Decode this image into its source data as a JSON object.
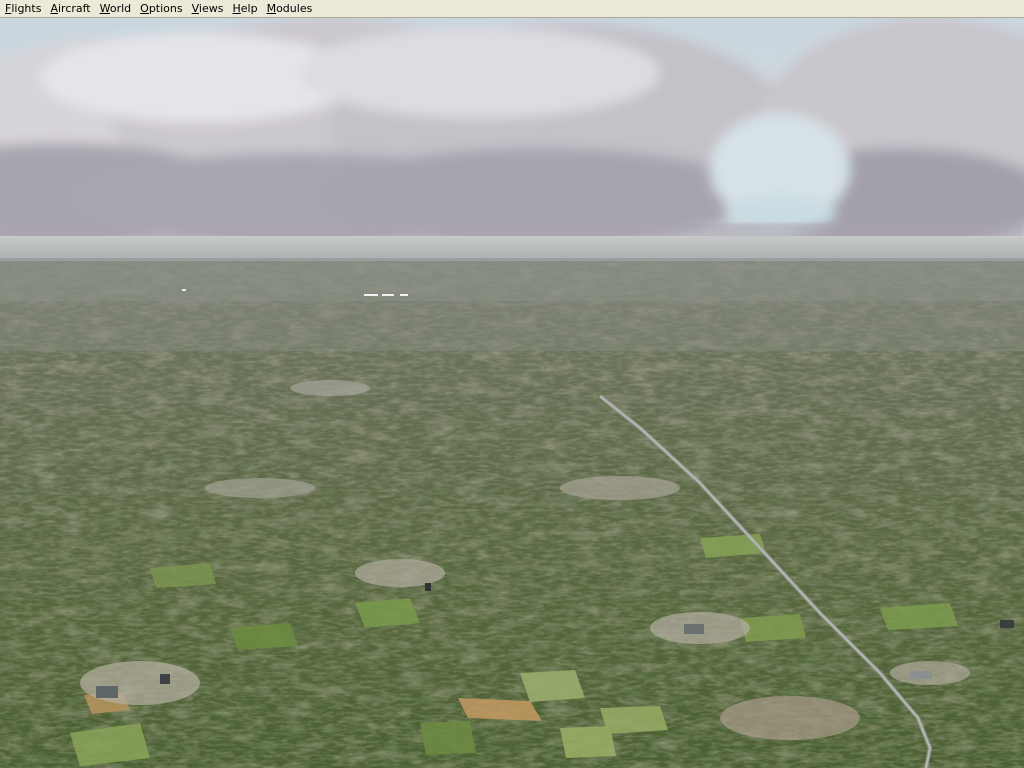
{
  "menu": {
    "items": [
      {
        "accel": "F",
        "rest": "lights"
      },
      {
        "accel": "A",
        "rest": "ircraft"
      },
      {
        "accel": "W",
        "rest": "orld"
      },
      {
        "accel": "O",
        "rest": "ptions"
      },
      {
        "accel": "V",
        "rest": "iews"
      },
      {
        "accel": "H",
        "rest": "elp"
      },
      {
        "accel": "M",
        "rest": "odules"
      }
    ]
  },
  "scene": {
    "sky_top": "#c8d4dc",
    "cloud_color": "#b8b4bc",
    "horizon_haze": "#bcc2c2",
    "ground_far": "#6c7460",
    "ground_mid": "#5c6a44",
    "ground_near": "#4a6030",
    "road_color": "#9a9c9a"
  }
}
